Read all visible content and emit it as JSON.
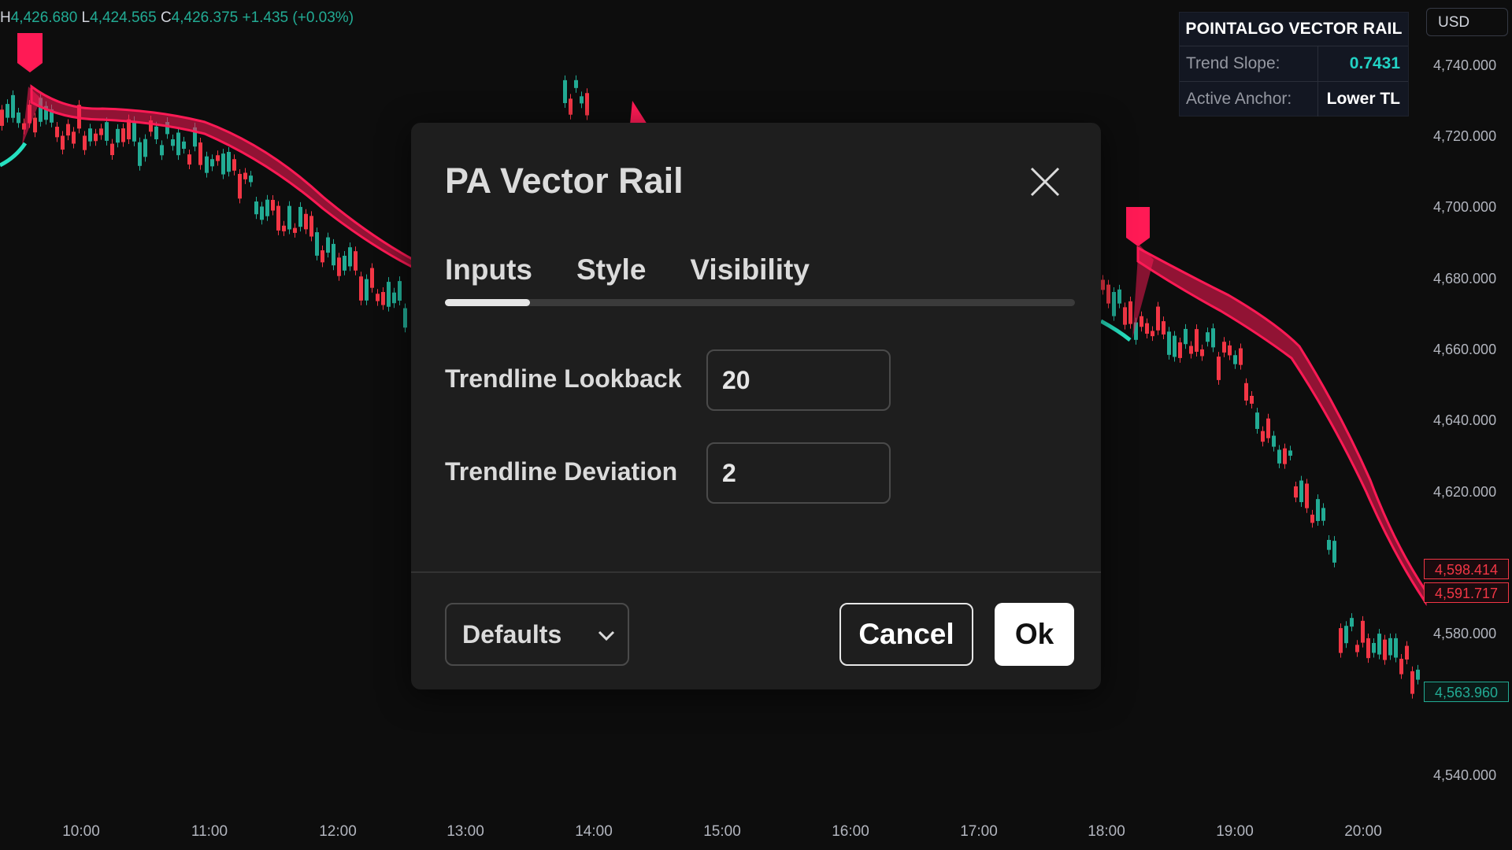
{
  "ohlc": {
    "high_key": "H",
    "high": "4,426.680",
    "low_key": "L",
    "low": "4,424.565",
    "close_key": "C",
    "close": "4,426.375",
    "change": "+1.435 (+0.03%)"
  },
  "currency_button": "USD",
  "info_panel": {
    "title": "POINTALGO VECTOR RAIL",
    "rows": [
      {
        "label": "Trend Slope:",
        "value": "0.7431"
      },
      {
        "label": "Active Anchor:",
        "value": "Lower TL"
      }
    ]
  },
  "price_axis": [
    "4,740.000",
    "4,720.000",
    "4,700.000",
    "4,680.000",
    "4,660.000",
    "4,640.000",
    "4,620.000",
    "4,580.000",
    "4,540.000"
  ],
  "price_tags": {
    "upper": "4,598.414",
    "lower": "4,591.717",
    "last": "4,563.960"
  },
  "time_axis": [
    "10:00",
    "11:00",
    "12:00",
    "13:00",
    "14:00",
    "15:00",
    "16:00",
    "17:00",
    "18:00",
    "19:00",
    "20:00"
  ],
  "colors": {
    "up": "#22ab94",
    "down": "#f23645",
    "rail": "#ff1a55",
    "rail_bull": "#26e0c0"
  },
  "dialog": {
    "title": "PA Vector Rail",
    "close_icon": "close-icon",
    "tabs": [
      {
        "label": "Inputs",
        "active": true
      },
      {
        "label": "Style",
        "active": false
      },
      {
        "label": "Visibility",
        "active": false
      }
    ],
    "fields": [
      {
        "label": "Trendline Lookback",
        "value": "20"
      },
      {
        "label": "Trendline Deviation",
        "value": "2"
      }
    ],
    "defaults_label": "Defaults",
    "cancel_label": "Cancel",
    "ok_label": "Ok"
  }
}
